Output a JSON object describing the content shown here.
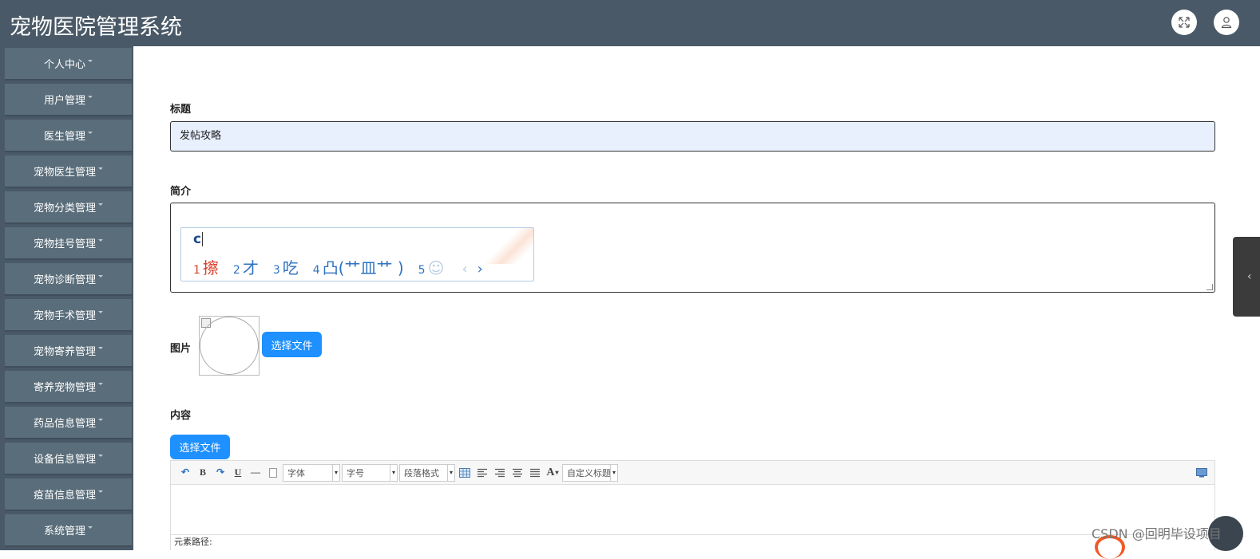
{
  "header": {
    "title": "宠物医院管理系统",
    "fullscreen_icon": "expand-arrows-icon",
    "user_icon": "user-icon"
  },
  "sidebar": {
    "items": [
      {
        "label": "个人中心"
      },
      {
        "label": "用户管理"
      },
      {
        "label": "医生管理"
      },
      {
        "label": "宠物医生管理"
      },
      {
        "label": "宠物分类管理"
      },
      {
        "label": "宠物挂号管理"
      },
      {
        "label": "宠物诊断管理"
      },
      {
        "label": "宠物手术管理"
      },
      {
        "label": "宠物寄养管理"
      },
      {
        "label": "寄养宠物管理"
      },
      {
        "label": "药品信息管理"
      },
      {
        "label": "设备信息管理"
      },
      {
        "label": "疫苗信息管理"
      },
      {
        "label": "系统管理"
      }
    ]
  },
  "form": {
    "title_label": "标题",
    "title_value": "发帖攻略",
    "intro_label": "简介",
    "image_label": "图片",
    "image_button": "选择文件",
    "content_label": "内容",
    "content_button": "选择文件"
  },
  "ime": {
    "input": "c",
    "candidates": [
      {
        "num": "1",
        "text": "擦"
      },
      {
        "num": "2",
        "text": "才"
      },
      {
        "num": "3",
        "text": "吃"
      },
      {
        "num": "4",
        "text": "凸(艹皿艹 )"
      },
      {
        "num": "5",
        "text": "☺"
      }
    ],
    "prev": "‹",
    "next": "›"
  },
  "editor": {
    "toolbar": {
      "undo": "↶",
      "bold": "B",
      "redo": "↷",
      "underline": "U",
      "hr": "—",
      "font_family": "字体",
      "font_size": "字号",
      "paragraph": "段落格式",
      "font_color": "A",
      "custom_title": "自定义标题"
    },
    "status": "元素路径:"
  },
  "watermark": "CSDN @回明毕设项目",
  "colors": {
    "header_bg": "#4a5967",
    "sidebar_item_bg": "#5a6d7a",
    "button_blue": "#1e90ff",
    "input_bg": "#e8f0fe"
  }
}
